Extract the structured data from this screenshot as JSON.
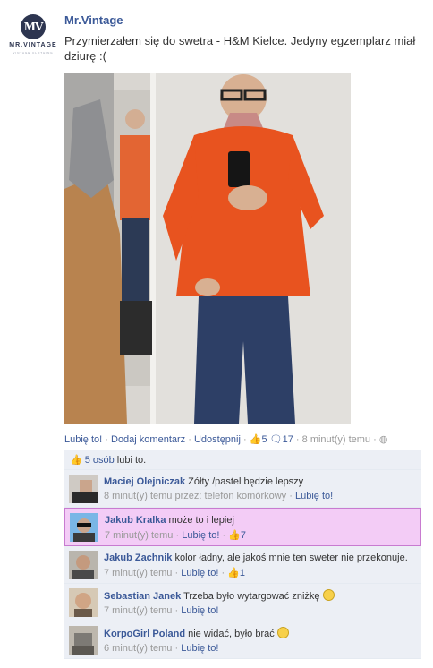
{
  "page": {
    "name": "Mr.Vintage",
    "avatar_monogram": "MV",
    "avatar_brand": "MR.VINTAGE",
    "avatar_tagline": "VINTAGE CLOTHING"
  },
  "post": {
    "text": "Przymierzałem się do swetra - H&M Kielce. Jedyny egzemplarz miał dziurę :(",
    "photo_icon": "mirror-selfie-photo"
  },
  "actions": {
    "like": "Lubię to!",
    "comment": "Dodaj komentarz",
    "share": "Udostępnij",
    "likes_count": "5",
    "comments_count": "17",
    "time": "8 minut(y) temu",
    "separator": "·"
  },
  "likes_summary": {
    "count_link": "5 osób",
    "suffix": "lubi to."
  },
  "comments": [
    {
      "author": "Maciej Olejniczak",
      "text": "Żółty /pastel będzie lepszy",
      "time": "8 minut(y) temu przez: telefon komórkowy",
      "like_label": "Lubię to!",
      "likes": "",
      "smiley": false
    },
    {
      "author": "Jakub Kralka",
      "text": "może to i lepiej",
      "time": "7 minut(y) temu",
      "like_label": "Lubię to!",
      "likes": "7",
      "smiley": false
    },
    {
      "author": "Jakub Zachnik",
      "text": "kolor ładny, ale jakoś mnie ten sweter nie przekonuje.",
      "time": "7 minut(y) temu",
      "like_label": "Lubię to!",
      "likes": "1",
      "smiley": false
    },
    {
      "author": "Sebastian Janek",
      "text": "Trzeba było wytargować zniżkę",
      "time": "7 minut(y) temu",
      "like_label": "Lubię to!",
      "likes": "",
      "smiley": true
    },
    {
      "author": "KorpoGirl Poland",
      "text": "nie widać, było brać",
      "time": "6 minut(y) temu",
      "like_label": "Lubię to!",
      "likes": "",
      "smiley": true
    }
  ],
  "colors": {
    "link": "#3b5998",
    "ufi_bg": "#eceff5",
    "highlight_bg": "#f3ccf6",
    "highlight_border": "#c87bd0",
    "sweater": "#e8531f"
  }
}
